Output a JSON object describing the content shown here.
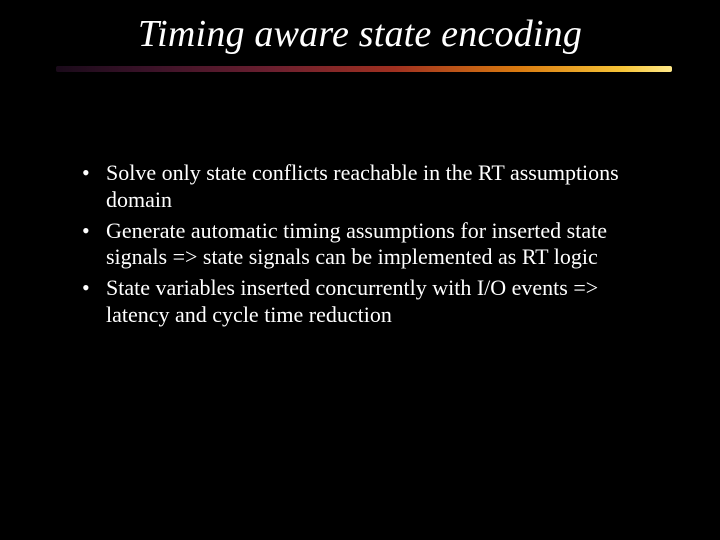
{
  "slide": {
    "title": "Timing aware state encoding",
    "bullets": [
      "Solve only state conflicts reachable in the RT assumptions domain",
      "Generate automatic timing assumptions for inserted state signals => state signals can be implemented as RT logic",
      "State variables inserted concurrently with I/O events => latency and cycle time reduction"
    ]
  }
}
